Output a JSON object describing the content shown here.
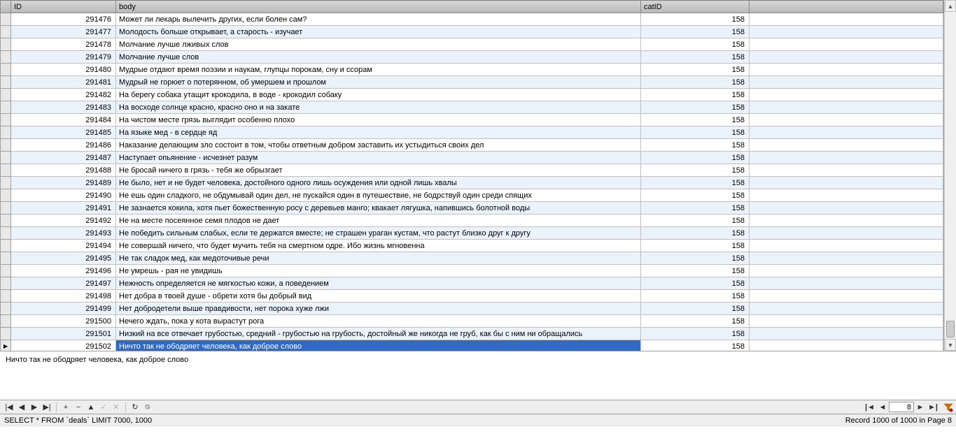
{
  "columns": {
    "rowhdr": "",
    "id": "ID",
    "body": "body",
    "catid": "catID",
    "blank": ""
  },
  "rows": [
    {
      "id": "291476",
      "body": "Может ли лекарь вылечить других, если болен сам?",
      "catid": "158"
    },
    {
      "id": "291477",
      "body": "Молодость больше открывает, а старость - изучает",
      "catid": "158"
    },
    {
      "id": "291478",
      "body": "Молчание лучше лживых слов",
      "catid": "158"
    },
    {
      "id": "291479",
      "body": "Молчание лучше слов",
      "catid": "158"
    },
    {
      "id": "291480",
      "body": "Мудрые отдают время поэзии и наукам, глупцы порокам, сну и ссорам",
      "catid": "158"
    },
    {
      "id": "291481",
      "body": "Мудрый не горюет о потерянном, об умершем и прошлом",
      "catid": "158"
    },
    {
      "id": "291482",
      "body": "На берегу собака утащит крокодила, в воде - крокодил собаку",
      "catid": "158"
    },
    {
      "id": "291483",
      "body": "На восходе солнце красно, красно оно и на закате",
      "catid": "158"
    },
    {
      "id": "291484",
      "body": "На чистом месте грязь выглядит особенно плохо",
      "catid": "158"
    },
    {
      "id": "291485",
      "body": "На языке мед - в сердце яд",
      "catid": "158"
    },
    {
      "id": "291486",
      "body": "Наказание делающим зло состоит в том, чтобы ответным добром заставить их устыдиться своих дел",
      "catid": "158"
    },
    {
      "id": "291487",
      "body": "Наступает опьянение - исчезнет разум",
      "catid": "158"
    },
    {
      "id": "291488",
      "body": "Не бросай ничего в грязь - тебя же обрызгает",
      "catid": "158"
    },
    {
      "id": "291489",
      "body": "Не было, нет и не будет человека, достойного одного лишь осуждения или одной лишь хвалы",
      "catid": "158"
    },
    {
      "id": "291490",
      "body": "Не ешь один сладкого, не обдумывай один дел, не пускайся один в путешествие, не бодрствуй один среди спящих",
      "catid": "158"
    },
    {
      "id": "291491",
      "body": "Не зазнается кокила, хотя пьет божественную росу с деревьев манго; квакает лягушка, напившись болотной воды",
      "catid": "158"
    },
    {
      "id": "291492",
      "body": "Не на месте посеянное семя плодов не дает",
      "catid": "158"
    },
    {
      "id": "291493",
      "body": "Не победить сильным слабых, если те держатся вместе; не страшен ураган кустам, что растут близко друг к другу",
      "catid": "158"
    },
    {
      "id": "291494",
      "body": "Не совершай ничего, что будет мучить тебя на смертном одре. Ибо жизнь мгновенна",
      "catid": "158"
    },
    {
      "id": "291495",
      "body": "Не так сладок мед, как медоточивые речи",
      "catid": "158"
    },
    {
      "id": "291496",
      "body": "Не умрешь - рая не увидишь",
      "catid": "158"
    },
    {
      "id": "291497",
      "body": "Нежность определяется не мягкостью кожи, а поведением",
      "catid": "158"
    },
    {
      "id": "291498",
      "body": "Нет добра в твоей душе - обрети хотя бы добрый вид",
      "catid": "158"
    },
    {
      "id": "291499",
      "body": "Нет добродетели выше правдивости, нет порока хуже лжи",
      "catid": "158"
    },
    {
      "id": "291500",
      "body": "Нечего ждать, пока у кота вырастут рога",
      "catid": "158"
    },
    {
      "id": "291501",
      "body": "Низкий на все отвечает грубостью, средний - грубостью на грубость, достойный же никогда не груб, как бы с ним ни обращались",
      "catid": "158"
    },
    {
      "id": "291502",
      "body": "Ничто так не ободряет человека, как доброе слово",
      "catid": "158",
      "selected": true
    }
  ],
  "detail_text": "Ничто так не ободряет человека, как доброе слово",
  "nav": {
    "first": "|◀",
    "prev": "◀",
    "next": "▶",
    "last": "▶|",
    "plus": "+",
    "minus": "−",
    "edit": "▲",
    "check": "✓",
    "cancel": "✕",
    "refresh": "↻",
    "stop": "⦸",
    "page_first": "|◀",
    "page_prev": "◀",
    "page_value": "8",
    "page_next": "▶",
    "page_last": "▶|"
  },
  "status": {
    "query": "SELECT * FROM `deals` LIMIT 7000, 1000",
    "record": "Record 1000 of 1000 in Page 8"
  }
}
